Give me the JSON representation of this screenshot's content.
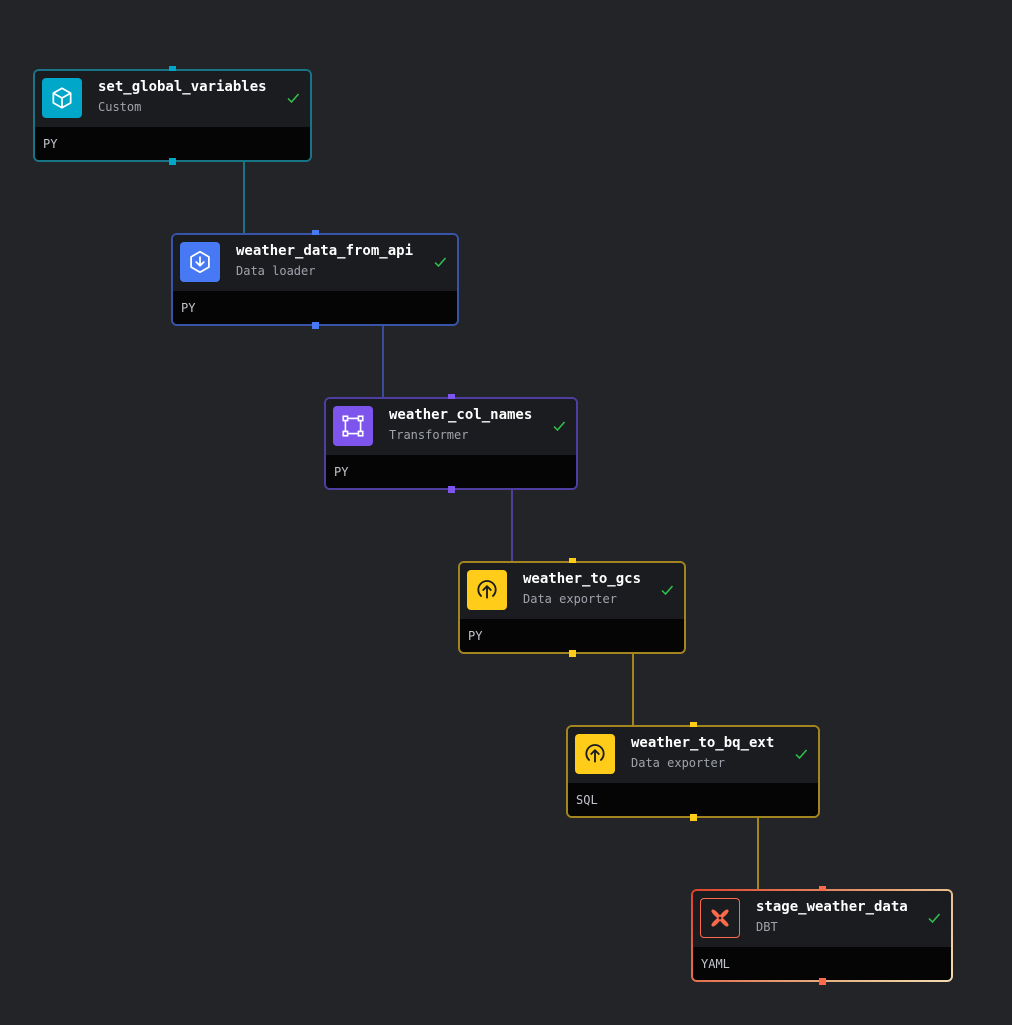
{
  "colors": {
    "canvas_bg": "#232428",
    "check": "#2fc24d",
    "custom": "#00a7c8",
    "data_loader": "#4779f4",
    "transformer": "#7d55ec",
    "data_exporter": "#ffcc19",
    "dbt": "#fc6a4c"
  },
  "nodes": [
    {
      "id": "set_global_variables",
      "name": "set_global_variables",
      "type": "Custom",
      "lang": "PY",
      "icon": "cube-icon",
      "status": "success",
      "accent": "#00a7c8",
      "border": "#187487",
      "edge_color": "#187487"
    },
    {
      "id": "weather_data_from_api",
      "name": "weather_data_from_api",
      "type": "Data loader",
      "lang": "PY",
      "icon": "download-icon",
      "status": "success",
      "accent": "#4779f4",
      "border": "#3754a8",
      "edge_color": "#3b4b9b"
    },
    {
      "id": "weather_col_names",
      "name": "weather_col_names",
      "type": "Transformer",
      "lang": "PY",
      "icon": "frame-icon",
      "status": "success",
      "accent": "#7d55ec",
      "border": "#503da2",
      "edge_color": "#4d3f9a"
    },
    {
      "id": "weather_to_gcs",
      "name": "weather_to_gcs",
      "type": "Data exporter",
      "lang": "PY",
      "icon": "upload-icon",
      "status": "success",
      "accent": "#ffcc19",
      "border": "#a2851f",
      "edge_color": "#a2851f"
    },
    {
      "id": "weather_to_bq_ext",
      "name": "weather_to_bq_ext",
      "type": "Data exporter",
      "lang": "SQL",
      "icon": "upload-icon",
      "status": "success",
      "accent": "#ffcc19",
      "border": "#a2851f",
      "edge_color": "#a2851f"
    },
    {
      "id": "stage_weather_data",
      "name": "stage_weather_data",
      "type": "DBT",
      "lang": "YAML",
      "icon": "dbt-icon",
      "status": "success",
      "accent": "#fc6a4c",
      "border": "#e0432a",
      "edge_color": "#a2851f"
    }
  ],
  "edges": [
    {
      "from": "set_global_variables",
      "to": "weather_data_from_api"
    },
    {
      "from": "weather_data_from_api",
      "to": "weather_col_names"
    },
    {
      "from": "weather_col_names",
      "to": "weather_to_gcs"
    },
    {
      "from": "weather_to_gcs",
      "to": "weather_to_bq_ext"
    },
    {
      "from": "weather_to_bq_ext",
      "to": "stage_weather_data"
    }
  ]
}
